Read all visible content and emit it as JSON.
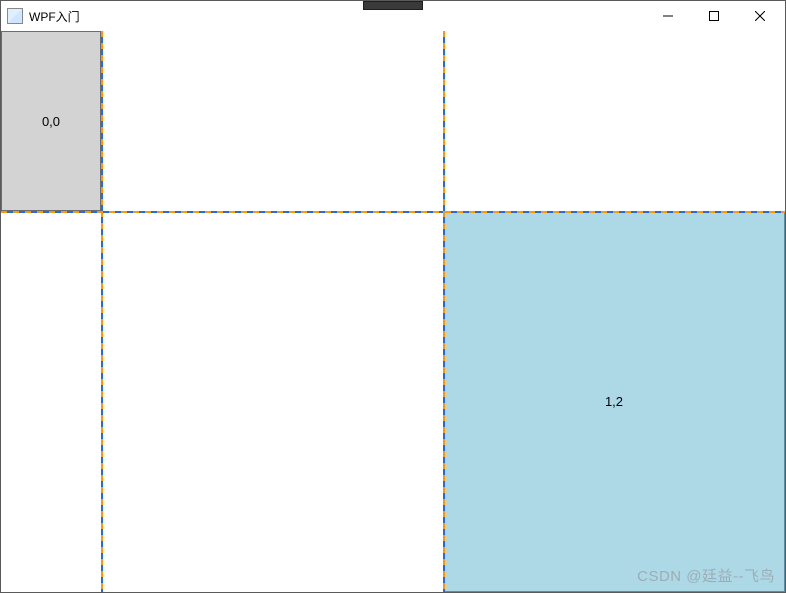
{
  "window": {
    "title": "WPF入门"
  },
  "grid": {
    "columns": [
      "100",
      "*",
      "*"
    ],
    "rows": [
      "180",
      "*"
    ],
    "cells": {
      "c00": {
        "label": "0,0"
      },
      "c12": {
        "label": "1,2"
      }
    }
  },
  "watermark": "CSDN @廷益--飞鸟"
}
